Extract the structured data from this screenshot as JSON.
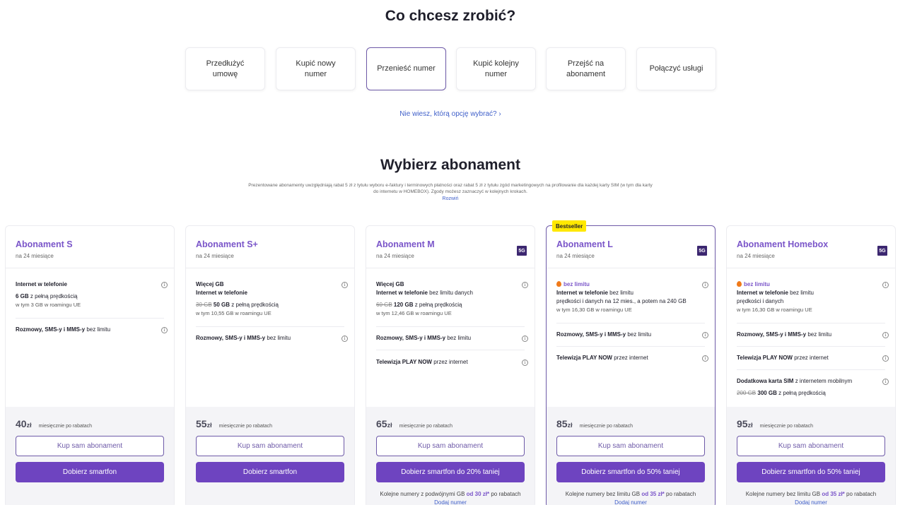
{
  "section1": {
    "title": "Co chcesz zrobić?",
    "options": [
      {
        "label": "Przedłużyć umowę"
      },
      {
        "label": "Kupić nowy numer"
      },
      {
        "label": "Przenieść numer"
      },
      {
        "label": "Kupić kolejny numer"
      },
      {
        "label": "Przejść na abonament"
      },
      {
        "label": "Połączyć usługi"
      }
    ],
    "active_index": 2,
    "help_link": "Nie wiesz, którą opcję wybrać? ›"
  },
  "section2": {
    "title": "Wybierz abonament",
    "disclaimer": "Prezentowane abonamenty uwzględniają rabat 5 zł z tytułu wyboru e-faktury i terminowych płatności oraz rabat 5 zł z tytułu zgód marketingowych na profilowanie dla każdej karty SIM (w tym dla karty do internetu w HOMEBOX). Zgody możesz zaznaczyć w kolejnych krokach.",
    "expand_link": "Rozwiń"
  },
  "bestseller_badge": "Bestseller",
  "badge_5g": "5G",
  "info_icon": "i",
  "plans": [
    {
      "name": "Abonament S",
      "sub": "na 24 miesiące",
      "f1_a": "Internet w telefonie",
      "f1_b_bold": "6 GB",
      "f1_b_rest": " z pełną prędkością",
      "f1_c": "w tym 3 GB w roamingu UE",
      "f2_bold": "Rozmowy, SMS-y i MMS-y",
      "f2_rest": " bez limitu",
      "price": "40",
      "currency": "zł",
      "price_note": "miesięcznie po rabatach",
      "btn_outline": "Kup sam abonament",
      "btn_fill": "Dobierz smartfon"
    },
    {
      "name": "Abonament S+",
      "sub": "na 24 miesiące",
      "f1_a": "Więcej GB",
      "f1_b": "Internet w telefonie",
      "f1_c_strike": "30 GB",
      "f1_c_bold": " 50 GB",
      "f1_c_rest": " z pełną prędkością",
      "f1_d": "w tym 10,55 GB w roamingu UE",
      "f2_bold": "Rozmowy, SMS-y i MMS-y",
      "f2_rest": " bez limitu",
      "price": "55",
      "currency": "zł",
      "price_note": "miesięcznie po rabatach",
      "btn_outline": "Kup sam abonament",
      "btn_fill": "Dobierz smartfon"
    },
    {
      "name": "Abonament M",
      "sub": "na 24 miesiące",
      "f1_a": "Więcej GB",
      "f1_b_bold": "Internet w telefonie",
      "f1_b_rest": " bez limitu danych",
      "f1_c_strike": "60 GB",
      "f1_c_bold": " 120 GB",
      "f1_c_rest": " z pełną prędkością",
      "f1_d": "w tym 12,46 GB w roamingu UE",
      "f2_bold": "Rozmowy, SMS-y i MMS-y",
      "f2_rest": " bez limitu",
      "f3_bold": "Telewizja PLAY NOW",
      "f3_rest": " przez internet",
      "price": "65",
      "currency": "zł",
      "price_note": "miesięcznie po rabatach",
      "btn_outline": "Kup sam abonament",
      "btn_fill": "Dobierz smartfon do 20% taniej",
      "more_a": "Kolejne numery z podwójnymi GB ",
      "more_b": "od 30 zł*",
      "more_c": " po rabatach",
      "more_link": "Dodaj numer"
    },
    {
      "name": "Abonament L",
      "sub": "na 24 miesiące",
      "f1_a": "bez limitu",
      "f1_b_bold": "Internet w telefonie",
      "f1_b_rest": " bez limitu",
      "f1_c": "prędkości i danych na 12 mies., a potem na 240 GB",
      "f1_d": "w tym 16,30 GB w roamingu UE",
      "f2_bold": "Rozmowy, SMS-y i MMS-y",
      "f2_rest": " bez limitu",
      "f3_bold": "Telewizja PLAY NOW",
      "f3_rest": " przez internet",
      "price": "85",
      "currency": "zł",
      "price_note": "miesięcznie po rabatach",
      "btn_outline": "Kup sam abonament",
      "btn_fill": "Dobierz smartfon do 50% taniej",
      "more_a": "Kolejne numery bez limitu GB ",
      "more_b": "od 35 zł*",
      "more_c": " po rabatach",
      "more_link": "Dodaj numer"
    },
    {
      "name": "Abonament Homebox",
      "sub": "na 24 miesiące",
      "f1_a": "bez limitu",
      "f1_b_bold": "Internet w telefonie",
      "f1_b_rest": " bez limitu",
      "f1_c": "prędkości i danych",
      "f1_d": "w tym 16,30 GB w roamingu UE",
      "f2_bold": "Rozmowy, SMS-y i MMS-y",
      "f2_rest": " bez limitu",
      "f3_bold": "Telewizja PLAY NOW",
      "f3_rest": " przez internet",
      "f4_bold": "Dodatkowa karta SIM",
      "f4_rest": " z internetem mobilnym",
      "f4_strike": "200 GB",
      "f4_bold2": " 300 GB",
      "f4_rest2": " z pełną prędkością",
      "price": "95",
      "currency": "zł",
      "price_note": "miesięcznie po rabatach",
      "btn_outline": "Kup sam abonament",
      "btn_fill": "Dobierz smartfon do 50% taniej",
      "more_a": "Kolejne numery bez limitu GB ",
      "more_b": "od 35 zł*",
      "more_c": " po rabatach",
      "more_link": "Dodaj numer"
    }
  ]
}
